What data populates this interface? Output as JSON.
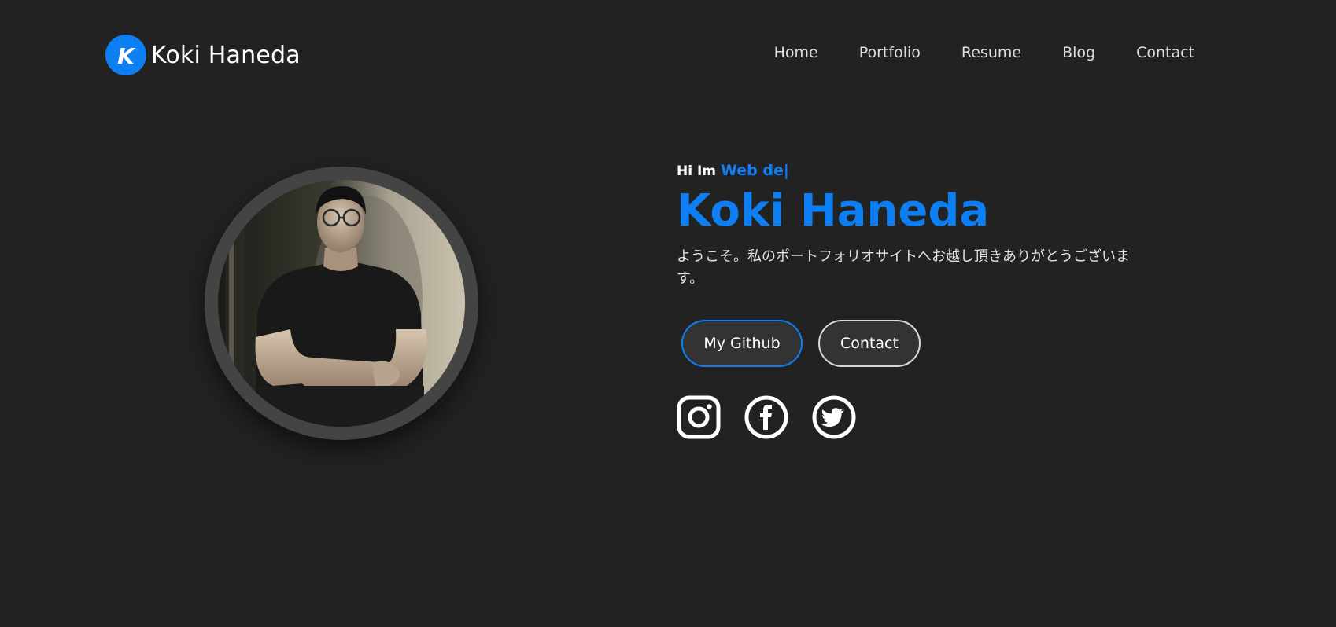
{
  "header": {
    "logo_letter": "K",
    "brand_name": "Koki Haneda",
    "nav": [
      {
        "label": "Home"
      },
      {
        "label": "Portfolio"
      },
      {
        "label": "Resume"
      },
      {
        "label": "Blog"
      },
      {
        "label": "Contact"
      }
    ]
  },
  "hero": {
    "greeting": "Hi Im",
    "typed_text": "Web de|",
    "name": "Koki Haneda",
    "intro": "ようこそ。私のポートフォリオサイトへお越し頂きありがとうございます。",
    "buttons": {
      "github": "My Github",
      "contact": "Contact"
    },
    "socials": [
      "instagram-icon",
      "facebook-icon",
      "twitter-icon"
    ]
  },
  "colors": {
    "background": "#222222",
    "accent": "#0d7ff2",
    "ring": "#444444",
    "button_bg": "#333333"
  }
}
